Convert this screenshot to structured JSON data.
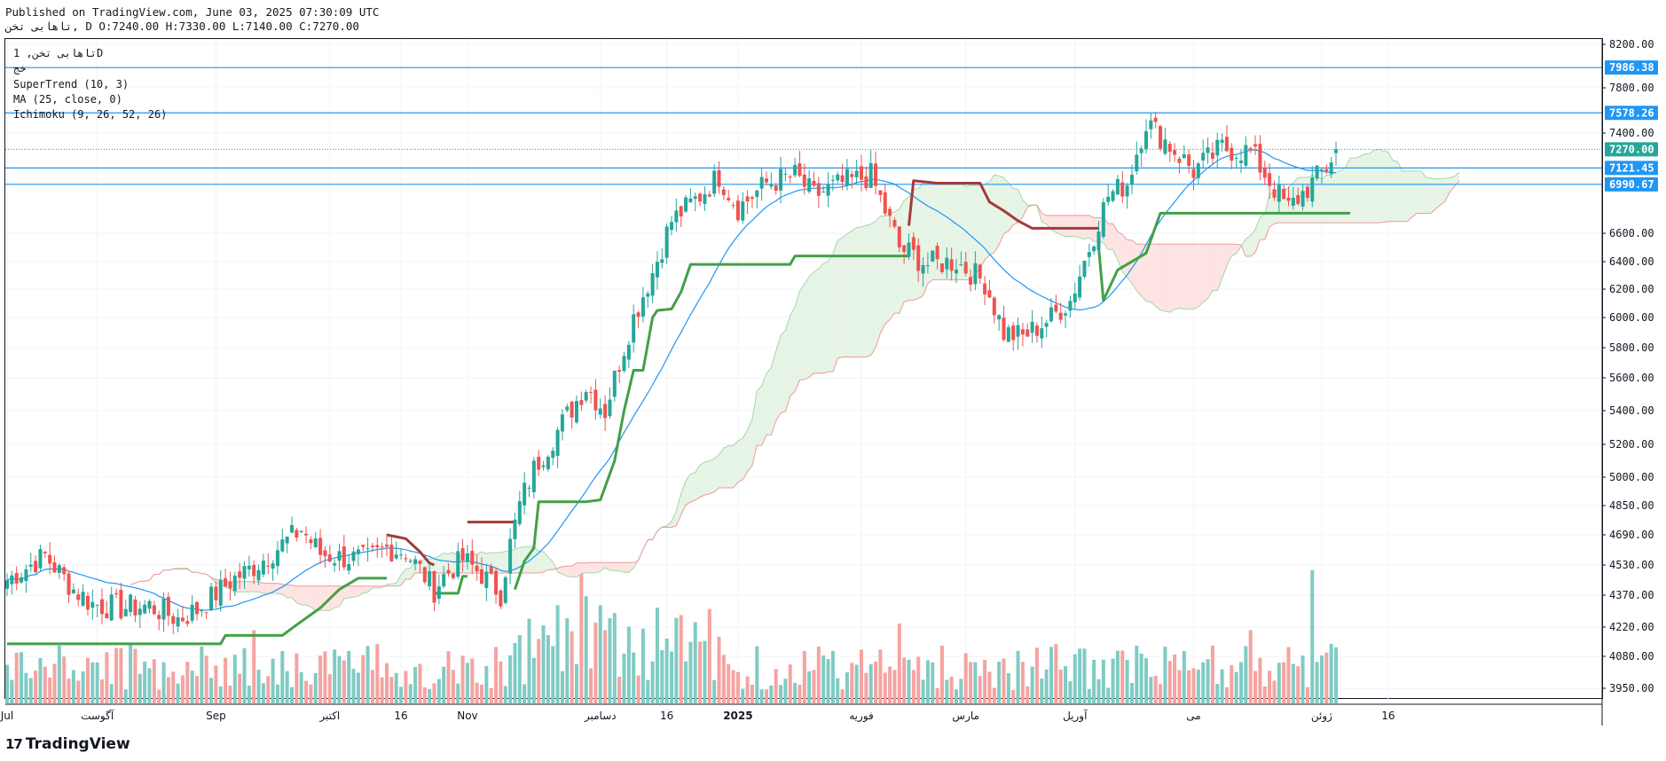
{
  "header": {
    "published": "Published on TradingView.com, June 03, 2025 07:30:09 UTC",
    "ohlc": "تاهابی تخن, D O:7240.00 H:7330.00 L:7140.00 C:7270.00"
  },
  "legend": {
    "symbol": "تاهابی تخن, 1D",
    "subtitle": "خج",
    "indicators": [
      "SuperTrend (10, 3)",
      "MA (25, close, 0)",
      "Ichimoku (9, 26, 52, 26)"
    ]
  },
  "brand": {
    "name": "TradingView",
    "logo_text": "17"
  },
  "colors": {
    "up": "#26a69a",
    "down": "#ef5350",
    "vol_up": "#80cbc4",
    "vol_down": "#f5a3a1",
    "supertrend_up": "#43a047",
    "supertrend_down": "#a33b3b",
    "ma": "#2196f3",
    "hline": "#2196f3",
    "cloud_bull": "#e6f4e6",
    "cloud_bear": "#fde4e2",
    "span_a": "#a5d6a7",
    "span_b": "#ef9a9a",
    "price_label": "#2196f3",
    "last_label": "#26a69a"
  },
  "chart_data": {
    "type": "candlestick",
    "title": "تاهابی تخن, 1D",
    "interval": "1D",
    "ylim": [
      3850,
      8300
    ],
    "y_ticks": [
      3950,
      4080,
      4220,
      4370,
      4530,
      4690,
      4850,
      5000,
      5200,
      5400,
      5600,
      5800,
      6000,
      6200,
      6400,
      6600,
      7400,
      7800,
      8200
    ],
    "y_tick_labels": [
      "3950.00",
      "4080.00",
      "4220.00",
      "4370.00",
      "4530.00",
      "4690.00",
      "4850.00",
      "5000.00",
      "5200.00",
      "5400.00",
      "5600.00",
      "5800.00",
      "6000.00",
      "6200.00",
      "6400.00",
      "6600.00",
      "7400.00",
      "7800.00",
      "8200.00"
    ],
    "x_ticks": [
      {
        "label": "Jul",
        "index": 0
      },
      {
        "label": "آگوست",
        "index": 19
      },
      {
        "label": "Sep",
        "index": 44
      },
      {
        "label": "اکتبر",
        "index": 68
      },
      {
        "label": "16",
        "index": 83
      },
      {
        "label": "Nov",
        "index": 97
      },
      {
        "label": "دسامبر",
        "index": 125
      },
      {
        "label": "16",
        "index": 139
      },
      {
        "label": "2025",
        "index": 154
      },
      {
        "label": "فوریه",
        "index": 180
      },
      {
        "label": "مارس",
        "index": 202
      },
      {
        "label": "آوریل",
        "index": 225
      },
      {
        "label": "می",
        "index": 250
      },
      {
        "label": "ژوئن",
        "index": 277
      },
      {
        "label": "16",
        "index": 291
      }
    ],
    "horizontal_lines": [
      7986.38,
      7578.26,
      7121.45,
      6990.67
    ],
    "price_labels": [
      {
        "value": 7986.38,
        "label": "7986.38"
      },
      {
        "value": 7578.26,
        "label": "7578.26"
      },
      {
        "value": 7270.0,
        "label": "7270.00"
      },
      {
        "value": 7121.45,
        "label": "7121.45"
      },
      {
        "value": 6990.67,
        "label": "6990.67"
      }
    ],
    "last_price": 7270.0,
    "anchors": [
      [
        0,
        4450
      ],
      [
        8,
        4580
      ],
      [
        14,
        4400
      ],
      [
        18,
        4330
      ],
      [
        24,
        4310
      ],
      [
        30,
        4320
      ],
      [
        36,
        4260
      ],
      [
        40,
        4300
      ],
      [
        48,
        4460
      ],
      [
        52,
        4520
      ],
      [
        58,
        4640
      ],
      [
        62,
        4720
      ],
      [
        66,
        4590
      ],
      [
        70,
        4570
      ],
      [
        76,
        4560
      ],
      [
        80,
        4620
      ],
      [
        84,
        4600
      ],
      [
        88,
        4470
      ],
      [
        90,
        4400
      ],
      [
        92,
        4470
      ],
      [
        96,
        4560
      ],
      [
        100,
        4480
      ],
      [
        104,
        4380
      ],
      [
        106,
        4640
      ],
      [
        108,
        4850
      ],
      [
        111,
        5050
      ],
      [
        116,
        5280
      ],
      [
        122,
        5550
      ],
      [
        126,
        5400
      ],
      [
        132,
        6000
      ],
      [
        136,
        6320
      ],
      [
        140,
        6700
      ],
      [
        146,
        6900
      ],
      [
        150,
        7060
      ],
      [
        154,
        6800
      ],
      [
        160,
        7000
      ],
      [
        166,
        7060
      ],
      [
        170,
        6900
      ],
      [
        176,
        7000
      ],
      [
        182,
        7060
      ],
      [
        188,
        6500
      ],
      [
        194,
        6380
      ],
      [
        200,
        6400
      ],
      [
        206,
        6250
      ],
      [
        210,
        5900
      ],
      [
        214,
        5870
      ],
      [
        220,
        6000
      ],
      [
        224,
        6120
      ],
      [
        228,
        6500
      ],
      [
        232,
        6900
      ],
      [
        236,
        7000
      ],
      [
        240,
        7500
      ],
      [
        246,
        7260
      ],
      [
        250,
        7100
      ],
      [
        256,
        7280
      ],
      [
        262,
        7250
      ],
      [
        268,
        6900
      ],
      [
        270,
        6800
      ],
      [
        274,
        6960
      ],
      [
        278,
        7130
      ],
      [
        280,
        7270
      ]
    ],
    "supertrend_segments": [
      {
        "trend": "up",
        "points": [
          [
            0,
            4140
          ],
          [
            45,
            4140
          ],
          [
            46,
            4180
          ],
          [
            58,
            4180
          ],
          [
            61,
            4230
          ],
          [
            66,
            4310
          ],
          [
            70,
            4400
          ],
          [
            74,
            4460
          ],
          [
            80,
            4460
          ]
        ]
      },
      {
        "trend": "down",
        "points": [
          [
            80,
            4690
          ],
          [
            84,
            4670
          ],
          [
            87,
            4600
          ],
          [
            89,
            4540
          ],
          [
            90,
            4530
          ]
        ]
      },
      {
        "trend": "up",
        "points": [
          [
            90,
            4380
          ],
          [
            95,
            4380
          ],
          [
            96,
            4470
          ],
          [
            97,
            4470
          ]
        ]
      },
      {
        "trend": "down",
        "points": [
          [
            97,
            4760
          ],
          [
            107,
            4760
          ]
        ]
      },
      {
        "trend": "up",
        "points": [
          [
            107,
            4400
          ],
          [
            109,
            4550
          ],
          [
            111,
            4620
          ],
          [
            112,
            4870
          ],
          [
            122,
            4870
          ],
          [
            125,
            4880
          ],
          [
            128,
            5100
          ],
          [
            130,
            5400
          ],
          [
            132,
            5650
          ],
          [
            134,
            5650
          ],
          [
            136,
            6000
          ],
          [
            137,
            6050
          ],
          [
            140,
            6060
          ],
          [
            142,
            6180
          ],
          [
            144,
            6380
          ],
          [
            165,
            6380
          ],
          [
            166,
            6440
          ],
          [
            190,
            6440
          ]
        ]
      },
      {
        "trend": "down",
        "points": [
          [
            190,
            6660
          ],
          [
            191,
            7020
          ],
          [
            196,
            7000
          ],
          [
            205,
            7000
          ],
          [
            207,
            6850
          ],
          [
            210,
            6780
          ],
          [
            213,
            6700
          ],
          [
            216,
            6640
          ],
          [
            230,
            6640
          ]
        ]
      },
      {
        "trend": "up",
        "points": [
          [
            230,
            6500
          ],
          [
            231,
            6120
          ],
          [
            234,
            6340
          ],
          [
            240,
            6460
          ],
          [
            243,
            6760
          ],
          [
            283,
            6760
          ]
        ]
      }
    ]
  }
}
